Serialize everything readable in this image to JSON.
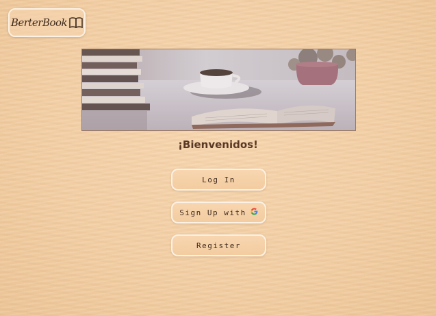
{
  "logo": {
    "text": "BerterBook",
    "icon": "open-book-icon"
  },
  "hero": {
    "image": "books-coffee-cup-open-book-photo"
  },
  "welcome": {
    "text": "¡Bienvenidos!"
  },
  "buttons": {
    "login": "Log In",
    "google": "Sign Up with",
    "google_icon": "google-g-icon",
    "register": "Register"
  },
  "colors": {
    "background": "#f3cfa5",
    "button_border": "#fbf1e4",
    "text": "#3e2a1e",
    "heading": "#5a3826"
  }
}
